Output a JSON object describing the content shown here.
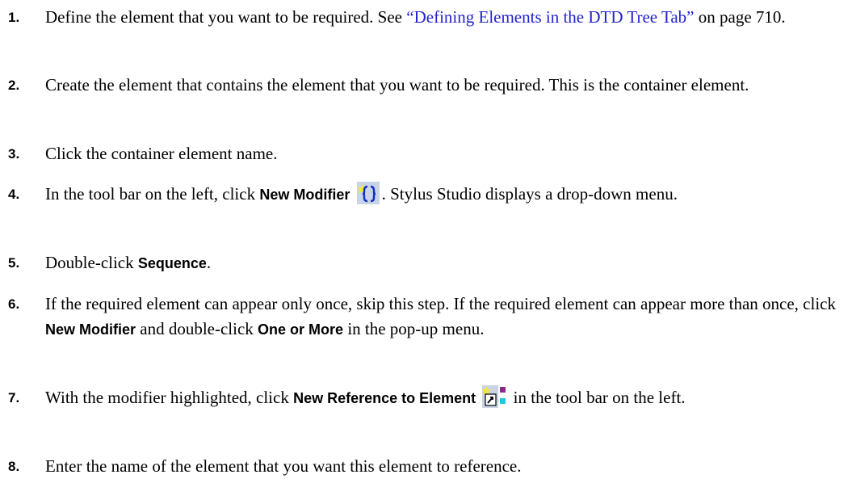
{
  "steps": [
    {
      "num": "1.",
      "pre": "Define the element that you want to be required. See ",
      "link": "“Defining Elements in the DTD Tree Tab”",
      "post": " on page 710."
    },
    {
      "num": "2.",
      "text": "Create the element that contains the element that you want to be required. This is the container element."
    },
    {
      "num": "3.",
      "text": "Click the container element name."
    },
    {
      "num": "4.",
      "pre": "In the tool bar on the left, click ",
      "bold": "New Modifier",
      "icon": "new-modifier-icon",
      "post": ". Stylus Studio displays a drop-down menu."
    },
    {
      "num": "5.",
      "pre": "Double-click ",
      "bold": "Sequence",
      "post": "."
    },
    {
      "num": "6.",
      "pre": "If the required element can appear only once, skip this step. If the required element can appear more than once, click ",
      "bold1": "New Modifier",
      "mid": " and double-click ",
      "bold2": "One or More",
      "post": " in the pop-up menu."
    },
    {
      "num": "7.",
      "pre": "With the modifier highlighted, click ",
      "bold": "New Reference to Element",
      "icon": "new-reference-icon",
      "post": " in the tool bar on the left."
    },
    {
      "num": "8.",
      "text": "Enter the name of the element that you want this element to reference."
    }
  ],
  "colors": {
    "link": "#2222cc"
  }
}
